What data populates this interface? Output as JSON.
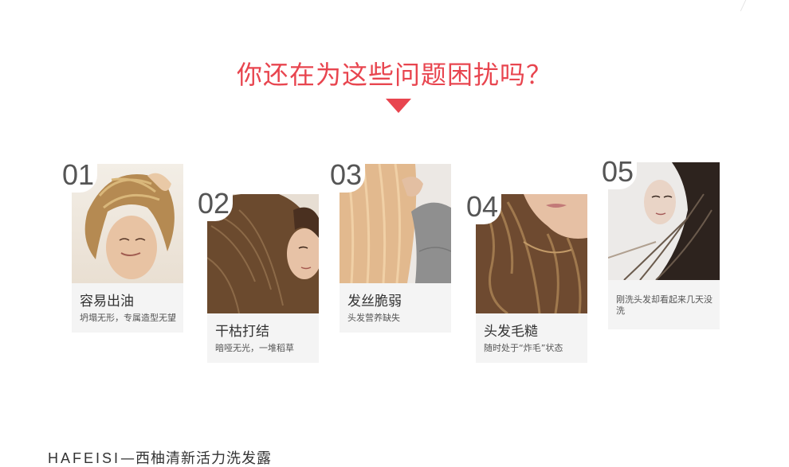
{
  "headline": "你还在为这些问题困扰吗？",
  "cards": [
    {
      "number": "01",
      "title": "容易出油",
      "desc": "坍塌无形，专属造型无望"
    },
    {
      "number": "02",
      "title": "干枯打结",
      "desc": "暗哑无光，一堆稻草"
    },
    {
      "number": "03",
      "title": "发丝脆弱",
      "desc": "头发营养缺失"
    },
    {
      "number": "04",
      "title": "头发毛糙",
      "desc": "随时处于“炸毛”状态"
    },
    {
      "number": "05",
      "title": "",
      "desc": "刚洗头发却看起来几天没洗"
    }
  ],
  "footer": {
    "brand": "HAFEISI",
    "separator": "—",
    "product": "西柚清新活力洗发露"
  },
  "colors": {
    "accent": "#e8454f",
    "card_bg": "#f4f4f4"
  }
}
